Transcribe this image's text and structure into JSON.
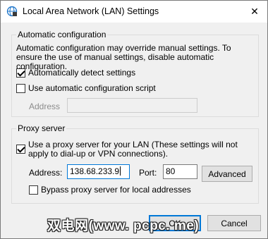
{
  "window": {
    "title": "Local Area Network (LAN) Settings",
    "close_symbol": "✕",
    "icon": "network-settings-icon"
  },
  "auto_config": {
    "group_label": "Automatic configuration",
    "description": "Automatic configuration may override manual settings.  To ensure the use of manual settings, disable automatic configuration.",
    "detect_label": "Automatically detect settings",
    "detect_checked": true,
    "script_label": "Use automatic configuration script",
    "script_checked": false,
    "address_label": "Address",
    "address_value": ""
  },
  "proxy": {
    "group_label": "Proxy server",
    "use_proxy_label": "Use a proxy server for your LAN (These settings will not apply to dial-up or VPN connections).",
    "use_proxy_checked": true,
    "address_label": "Address:",
    "address_value": "138.68.233.9",
    "port_label": "Port:",
    "port_value": "80",
    "advanced_label": "Advanced",
    "bypass_label": "Bypass proxy server for local addresses",
    "bypass_checked": false
  },
  "footer": {
    "ok_label": "OK",
    "cancel_label": "Cancel"
  },
  "watermark": {
    "text": "双电网(www. pcpc. me)"
  },
  "colors": {
    "accent": "#0078d7",
    "window_bg": "#f0f0f0",
    "disabled_text": "#8c8c8c"
  }
}
